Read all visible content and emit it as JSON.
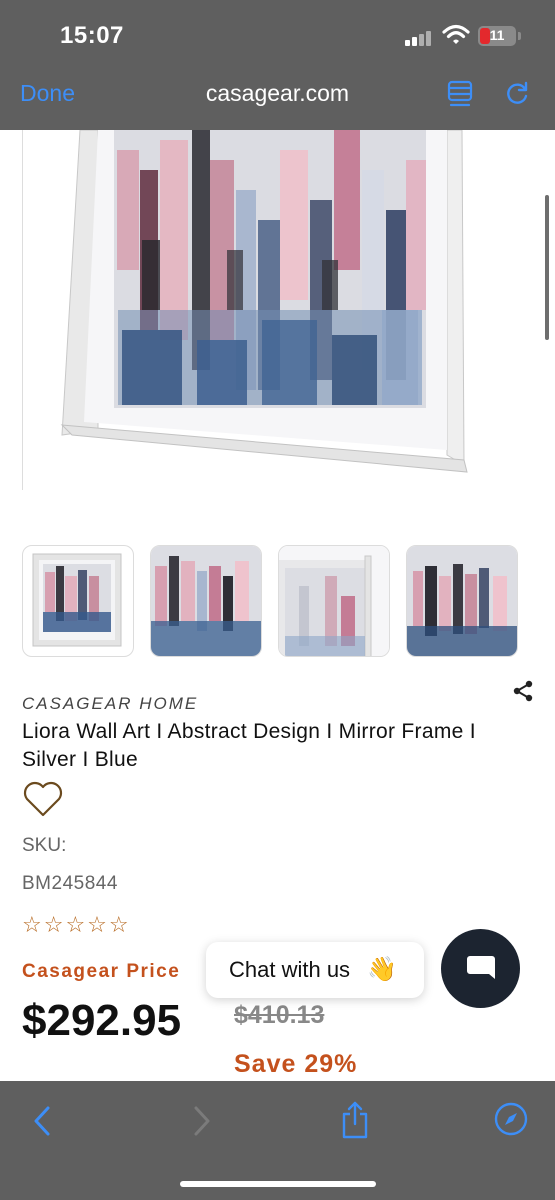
{
  "status_bar": {
    "time": "15:07",
    "battery_level": "11"
  },
  "browser": {
    "done_label": "Done",
    "domain": "casagear.com"
  },
  "product": {
    "brand": "CASAGEAR HOME",
    "title": "Liora Wall Art I Abstract Design I Mirror Frame I Silver I Blue",
    "sku_label": "SKU:",
    "sku_value": "BM245844",
    "rating_stars": "☆☆☆☆☆",
    "rating_value": 0,
    "price_label": "Casagear Price",
    "price": "$292.95",
    "original_price": "$410.13",
    "savings": "Save 29%",
    "thumbnail_count": 4
  },
  "chat": {
    "label": "Chat with us",
    "wave_emoji": "👋"
  },
  "colors": {
    "accent_blue": "#3d8ef7",
    "chrome_gray": "#5f5f5f",
    "price_orange": "#c4511d",
    "chat_dark": "#1c2430",
    "battery_red": "#e3292d"
  }
}
